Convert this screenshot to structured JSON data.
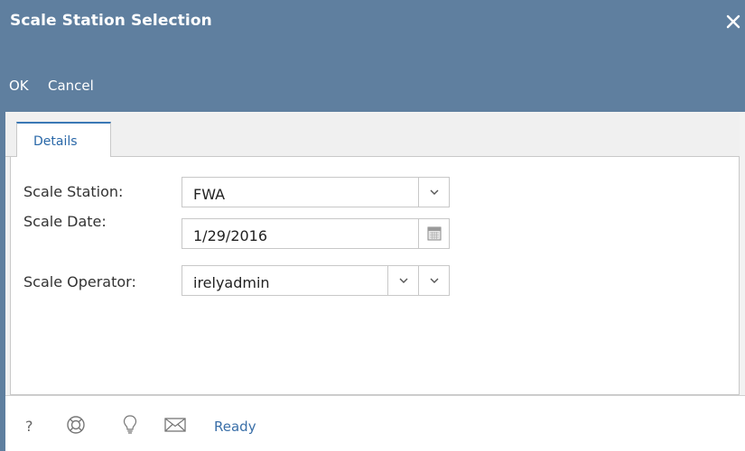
{
  "window": {
    "title": "Scale Station Selection",
    "close_icon": "close-icon"
  },
  "toolbar": {
    "ok_label": "OK",
    "cancel_label": "Cancel"
  },
  "tabs": [
    {
      "label": "Details",
      "active": true
    }
  ],
  "form": {
    "scale_station": {
      "label": "Scale Station:",
      "value": "FWA"
    },
    "scale_date": {
      "label": "Scale Date:",
      "value": "1/29/2016"
    },
    "scale_operator": {
      "label": "Scale Operator:",
      "value": "irelyadmin"
    }
  },
  "statusbar": {
    "help_glyph": "?",
    "icons": [
      "help-icon",
      "support-icon",
      "lightbulb-icon",
      "mail-icon"
    ],
    "status_text": "Ready"
  },
  "colors": {
    "header": "#5f7f9f",
    "accent": "#3a78b5",
    "link": "#3a6fa8"
  }
}
